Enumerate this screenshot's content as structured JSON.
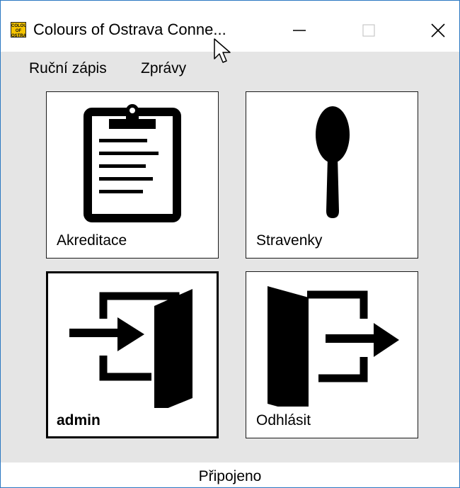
{
  "window": {
    "title": "Colours of Ostrava Conne...",
    "icon_text": "COLOURS OF OSTRAVA",
    "accent_color": "#2b78c2"
  },
  "menu": {
    "items": [
      "Ruční zápis",
      "Zprávy"
    ]
  },
  "tiles": [
    {
      "label": "Akreditace",
      "icon": "clipboard-icon"
    },
    {
      "label": "Stravenky",
      "icon": "spoon-icon"
    },
    {
      "label": "admin",
      "icon": "login-door-icon"
    },
    {
      "label": "Odhlásit",
      "icon": "logout-door-icon"
    }
  ],
  "status": {
    "text": "Připojeno"
  }
}
